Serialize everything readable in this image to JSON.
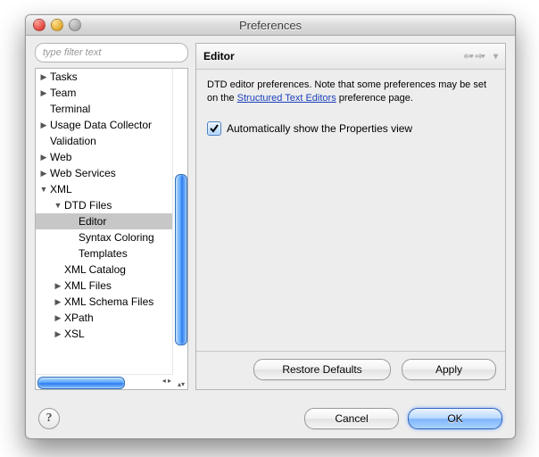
{
  "window": {
    "title": "Preferences"
  },
  "filter": {
    "placeholder": "type filter text"
  },
  "tree": [
    {
      "label": "Tasks",
      "depth": 0,
      "arrow": "right",
      "selected": false
    },
    {
      "label": "Team",
      "depth": 0,
      "arrow": "right",
      "selected": false
    },
    {
      "label": "Terminal",
      "depth": 0,
      "arrow": "",
      "selected": false
    },
    {
      "label": "Usage Data Collector",
      "depth": 0,
      "arrow": "right",
      "selected": false
    },
    {
      "label": "Validation",
      "depth": 0,
      "arrow": "",
      "selected": false
    },
    {
      "label": "Web",
      "depth": 0,
      "arrow": "right",
      "selected": false
    },
    {
      "label": "Web Services",
      "depth": 0,
      "arrow": "right",
      "selected": false
    },
    {
      "label": "XML",
      "depth": 0,
      "arrow": "down",
      "selected": false
    },
    {
      "label": "DTD Files",
      "depth": 1,
      "arrow": "down",
      "selected": false
    },
    {
      "label": "Editor",
      "depth": 2,
      "arrow": "",
      "selected": true
    },
    {
      "label": "Syntax Coloring",
      "depth": 2,
      "arrow": "",
      "selected": false
    },
    {
      "label": "Templates",
      "depth": 2,
      "arrow": "",
      "selected": false
    },
    {
      "label": "XML Catalog",
      "depth": 1,
      "arrow": "",
      "selected": false
    },
    {
      "label": "XML Files",
      "depth": 1,
      "arrow": "right",
      "selected": false
    },
    {
      "label": "XML Schema Files",
      "depth": 1,
      "arrow": "right",
      "selected": false
    },
    {
      "label": "XPath",
      "depth": 1,
      "arrow": "right",
      "selected": false
    },
    {
      "label": "XSL",
      "depth": 1,
      "arrow": "right",
      "selected": false
    }
  ],
  "editor": {
    "heading": "Editor",
    "desc_pre": "DTD editor preferences.  Note that some preferences may be set on the ",
    "desc_link": "Structured Text Editors",
    "desc_post": " preference page.",
    "checkbox_label": "Automatically show the Properties view",
    "checkbox_checked": true
  },
  "buttons": {
    "restore_defaults": "Restore Defaults",
    "apply": "Apply",
    "cancel": "Cancel",
    "ok": "OK"
  }
}
